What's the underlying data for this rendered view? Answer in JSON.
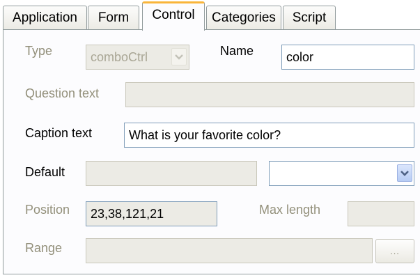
{
  "tabs": [
    {
      "label": "Application"
    },
    {
      "label": "Form"
    },
    {
      "label": "Control"
    },
    {
      "label": "Categories"
    },
    {
      "label": "Script"
    }
  ],
  "form": {
    "type_label": "Type",
    "type_value": "comboCtrl",
    "name_label": "Name",
    "name_value": "color",
    "question_label": "Question text",
    "question_value": "",
    "caption_label": "Caption text",
    "caption_value": "What is your favorite color?",
    "default_label": "Default",
    "default_value": "",
    "default_select_value": "",
    "position_label": "Position",
    "position_value": "23,38,121,21",
    "maxlength_label": "Max length",
    "maxlength_value": "",
    "range_label": "Range",
    "range_value": "",
    "browse_label": "..."
  },
  "colors": {
    "active_tab_accent": "#f9b53a",
    "input_border": "#7f9db9",
    "disabled_fill": "#ecebe5",
    "disabled_text": "#93907b"
  },
  "icons": {
    "dropdown": "chevron-down-icon"
  }
}
